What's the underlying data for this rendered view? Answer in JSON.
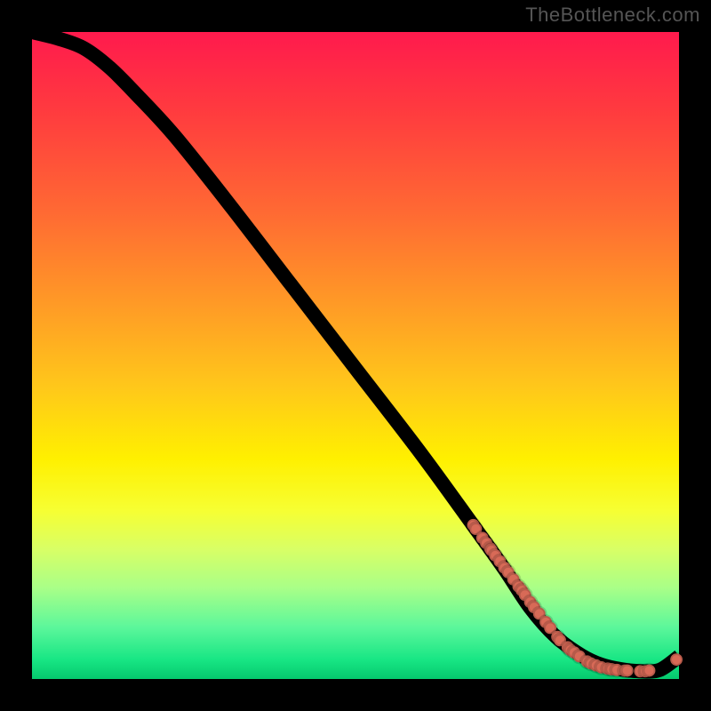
{
  "watermark": "TheBottleneck.com",
  "chart_data": {
    "type": "line",
    "title": "",
    "xlabel": "",
    "ylabel": "",
    "xlim": [
      0,
      100
    ],
    "ylim": [
      0,
      100
    ],
    "axes_visible": false,
    "grid": false,
    "background_gradient": [
      "#ff1a4d",
      "#ff9a26",
      "#fff000",
      "#05c96e"
    ],
    "curve": {
      "x": [
        0,
        4,
        8,
        12,
        16,
        22,
        30,
        40,
        50,
        60,
        68,
        73,
        77,
        81,
        85,
        88,
        91,
        94,
        97,
        100
      ],
      "y": [
        100,
        99,
        97.5,
        94.5,
        90.5,
        84,
        74,
        61,
        48,
        35,
        24,
        17,
        11,
        6.5,
        3.6,
        2.2,
        1.5,
        1.2,
        1.4,
        3.5
      ]
    },
    "points": {
      "x": [
        68.2,
        68.6,
        69.6,
        70.2,
        70.8,
        71.0,
        71.6,
        72.3,
        73.0,
        73.6,
        74.4,
        75.2,
        75.7,
        76.2,
        77.0,
        77.6,
        78.4,
        79.4,
        80.1,
        81.2,
        81.6,
        82.8,
        83.2,
        83.8,
        84.6,
        85.8,
        86.4,
        87.2,
        88.0,
        89.0,
        89.6,
        90.4,
        91.6,
        92.0,
        94.0,
        94.8,
        95.4,
        99.6
      ],
      "y": [
        23.8,
        23.2,
        21.8,
        21.0,
        20.2,
        19.9,
        19.1,
        18.2,
        17.2,
        16.5,
        15.4,
        14.3,
        13.7,
        13.0,
        11.9,
        11.1,
        10.1,
        8.8,
        7.9,
        6.5,
        6.0,
        4.9,
        4.5,
        4.1,
        3.5,
        2.7,
        2.4,
        2.1,
        1.8,
        1.6,
        1.5,
        1.4,
        1.3,
        1.3,
        1.2,
        1.2,
        1.3,
        3.0
      ]
    }
  }
}
